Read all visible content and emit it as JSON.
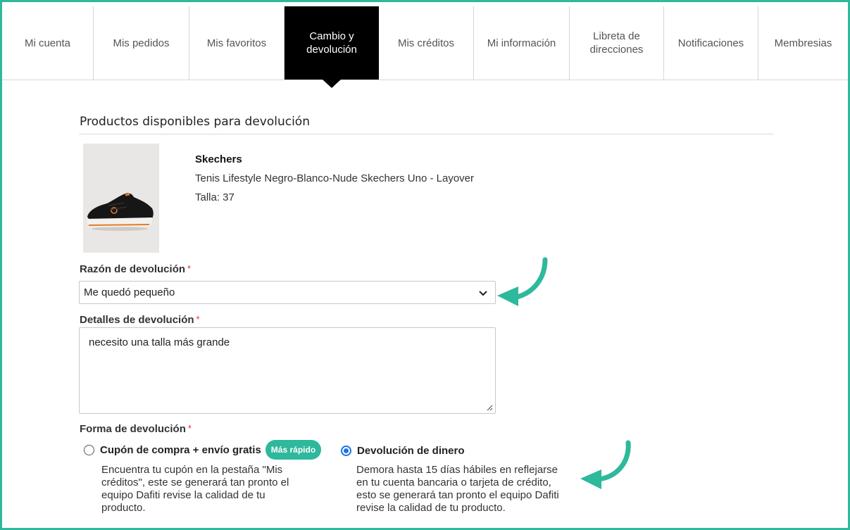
{
  "tabs": [
    {
      "label": "Mi cuenta",
      "active": false
    },
    {
      "label": "Mis pedidos",
      "active": false
    },
    {
      "label": "Mis favoritos",
      "active": false
    },
    {
      "label": "Cambio y\ndevolución",
      "active": true
    },
    {
      "label": "Mis créditos",
      "active": false
    },
    {
      "label": "Mi información",
      "active": false
    },
    {
      "label": "Libreta de\ndirecciones",
      "active": false
    },
    {
      "label": "Notificaciones",
      "active": false
    },
    {
      "label": "Membresias",
      "active": false
    }
  ],
  "section_title": "Productos disponibles para devolución",
  "product": {
    "brand": "Skechers",
    "name": "Tenis Lifestyle Negro-Blanco-Nude Skechers Uno - Layover",
    "size": "Talla: 37"
  },
  "return_reason": {
    "label": "Razón de devolución",
    "required_mark": "*",
    "selected": "Me quedó pequeño"
  },
  "return_details": {
    "label": "Detalles de devolución",
    "required_mark": "*",
    "value": "necesito una talla más grande"
  },
  "return_method": {
    "label": "Forma de devolución",
    "required_mark": "*",
    "options": [
      {
        "label": "Cupón de compra + envío gratis",
        "badge": "Más rápido",
        "checked": false,
        "description": "Encuentra tu cupón en la pestaña \"Mis\ncréditos\", este se generará tan pronto el\nequipo Dafiti revise la calidad de tu\nproducto."
      },
      {
        "label": "Devolución de dinero",
        "checked": true,
        "description": "Demora hasta 15 días hábiles en reflejarse\nen tu cuenta bancaria o tarjeta de crédito,\nesto se generará tan pronto el equipo Dafiti\nrevise la calidad de tu producto."
      }
    ]
  },
  "colors": {
    "accent": "#2eb89c",
    "active_tab": "#000000",
    "radio": "#1a73e8",
    "required": "#e03131"
  }
}
